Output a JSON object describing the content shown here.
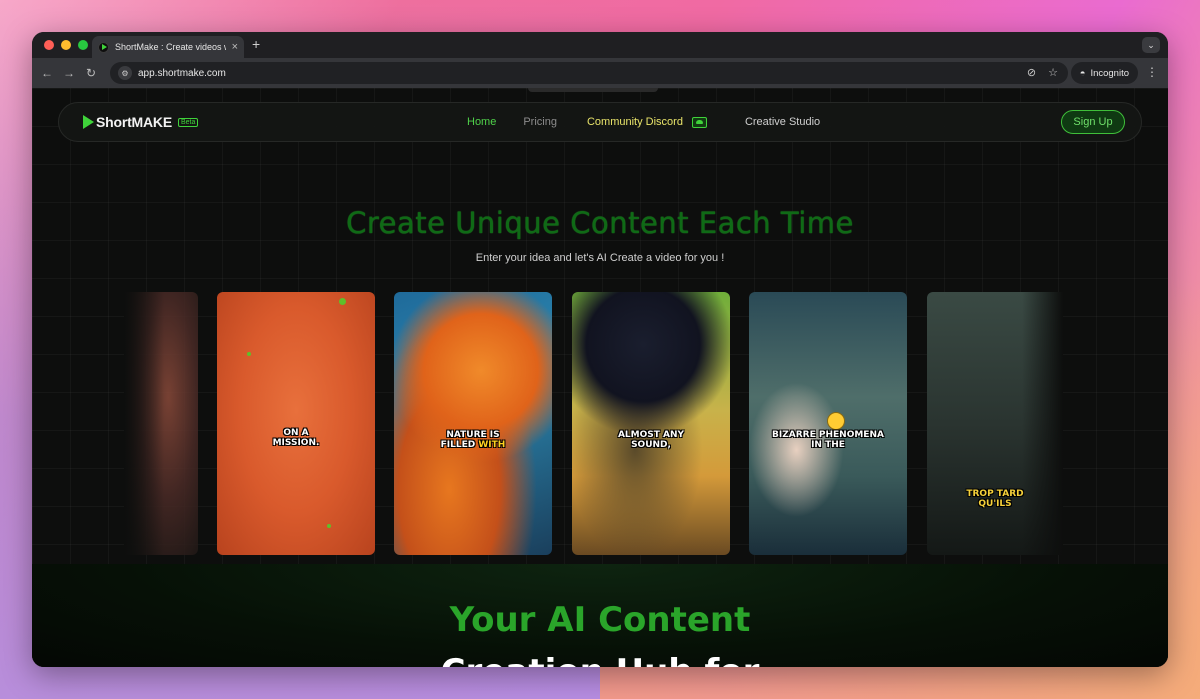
{
  "browser": {
    "tab_title": "ShortMake : Create videos wi",
    "tab_close": "×",
    "new_tab": "+",
    "url": "app.shortmake.com",
    "incognito_label": "Incognito"
  },
  "navbar": {
    "logo_text": "ShortMAKE",
    "beta_badge": "Beta",
    "links": {
      "home": "Home",
      "pricing": "Pricing",
      "discord": "Community Discord",
      "studio": "Creative Studio"
    },
    "signup_label": "Sign Up"
  },
  "hero": {
    "title": "Create Unique Content Each Time",
    "subtitle": "Enter your idea and let's AI Create a video for you !"
  },
  "cards": [
    {
      "caption_line1": "ON A",
      "caption_line2": "MISSION."
    },
    {
      "caption_line1": "NATURE IS",
      "caption_line2a": "FILLED ",
      "caption_line2b": "WITH"
    },
    {
      "caption_line1": "ALMOST ANY",
      "caption_line2": "SOUND,"
    },
    {
      "caption_line1": "BIZARRE PHENOMENA",
      "caption_line2": "IN THE"
    },
    {
      "caption_line1": "TROP TARD",
      "caption_line2": "QU'ILS"
    }
  ],
  "bottom": {
    "line1": "Your AI Content",
    "line2": "Creation Hub for"
  },
  "colors": {
    "accent_green": "#3fd33a",
    "discord_yellow": "#e9e46a"
  }
}
